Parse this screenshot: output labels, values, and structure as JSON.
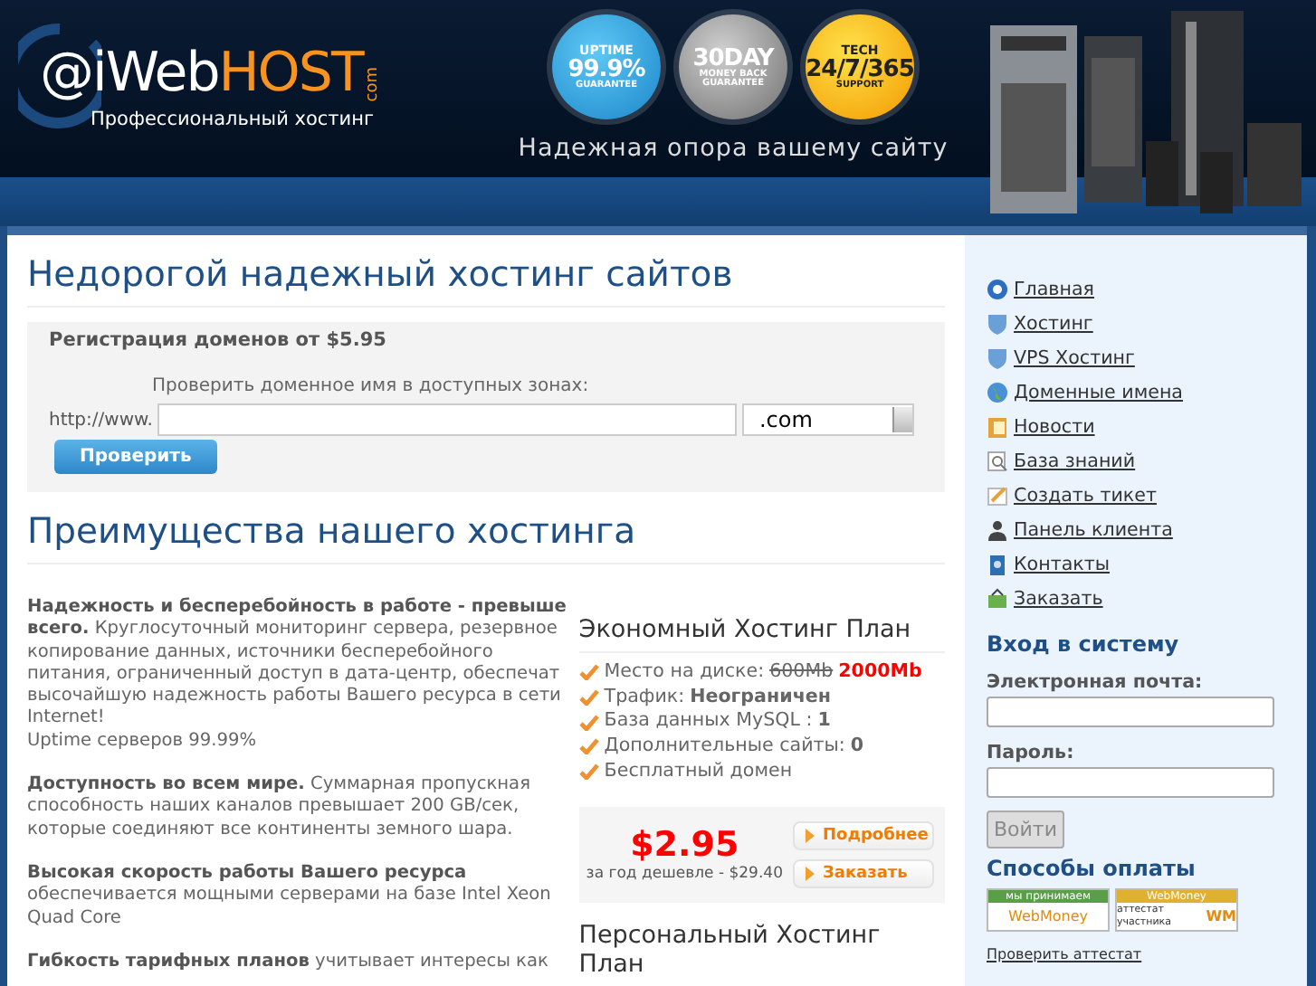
{
  "header": {
    "logo": {
      "mark": "@i",
      "word": "Web",
      "accent": "HOST",
      "suffix": "com",
      "tagline": "Профессиональный хостинг"
    },
    "badges": [
      {
        "kind": "blue",
        "top": "UPTIME",
        "main": "99.9%",
        "bottom": "GUARANTEE"
      },
      {
        "kind": "silver",
        "main": "30DAY",
        "bottom": "MONEY BACK GUARANTEE"
      },
      {
        "kind": "gold",
        "top": "TECH",
        "main": "24/7/365",
        "bottom": "SUPPORT"
      }
    ],
    "slogan": "Надежная опора вашему сайту"
  },
  "main": {
    "title": "Недорогой надежный хостинг сайтов",
    "domain_form": {
      "heading": "Регистрация доменов от $5.95",
      "hint": "Проверить доменное имя в доступных зонах:",
      "prefix": "http://www.",
      "zone": ".com",
      "button": "Проверить"
    },
    "advantages_title": "Преимущества нашего хостинга",
    "advantages": [
      {
        "text": "**Надежность и бесперебойность в работе - превыше всего.** Круглосуточный мониторинг сервера, резервное копирование данных, источники бесперебойного питания, ограниченный доступ в дата-центр, обеспечат высочайшую надежность работы Вашего ресурса в сети Internet!",
        "note": "Uptime серверов 99.99%"
      },
      {
        "text": "**Доступность во всем мире.** Суммарная пропускная способность наших каналов превышает 200 GB/сек, которые соединяют все континенты земного шара."
      },
      {
        "text": "**Высокая скорость работы Вашего ресурса** обеспечивается мощными серверами на базе Intel Xeon Quad Core"
      },
      {
        "text": "**Гибкость тарифных планов** учитывает интересы как"
      }
    ],
    "plans": [
      {
        "title": "Экономный Хостинг План",
        "features": [
          {
            "label": "Место на диске:",
            "old": "600Mb",
            "new": "2000Mb"
          },
          {
            "label": "Трафик:",
            "value": "Неограничен"
          },
          {
            "label": "База данных MySQL :",
            "value": "1"
          },
          {
            "label": "Дополнительные сайты:",
            "value": "0"
          },
          {
            "label": "Бесплатный домен"
          }
        ],
        "price": "$2.95",
        "price_note": "за год дешевле - $29.40",
        "buttons": [
          "Подробнее",
          "Заказать"
        ]
      },
      {
        "title": "Персональный Хостинг План"
      }
    ]
  },
  "sidebar": {
    "menu": [
      "Главная",
      "Хостинг",
      "VPS Хостинг",
      "Доменные имена",
      "Новости",
      "База знаний",
      "Создать тикет",
      "Панель клиента",
      "Контакты",
      "Заказать"
    ],
    "login": {
      "title": "Вход в систему",
      "email_label": "Электронная почта:",
      "password_label": "Пароль:",
      "button": "Войти"
    },
    "payment": {
      "title": "Способы оплаты",
      "badges": [
        {
          "top": "мы принимаем",
          "bottom": "WebMoney"
        },
        {
          "top": "WebMoney",
          "bottom": "аттестат участника",
          "mark": "WM"
        }
      ],
      "link": "Проверить аттестат"
    }
  }
}
